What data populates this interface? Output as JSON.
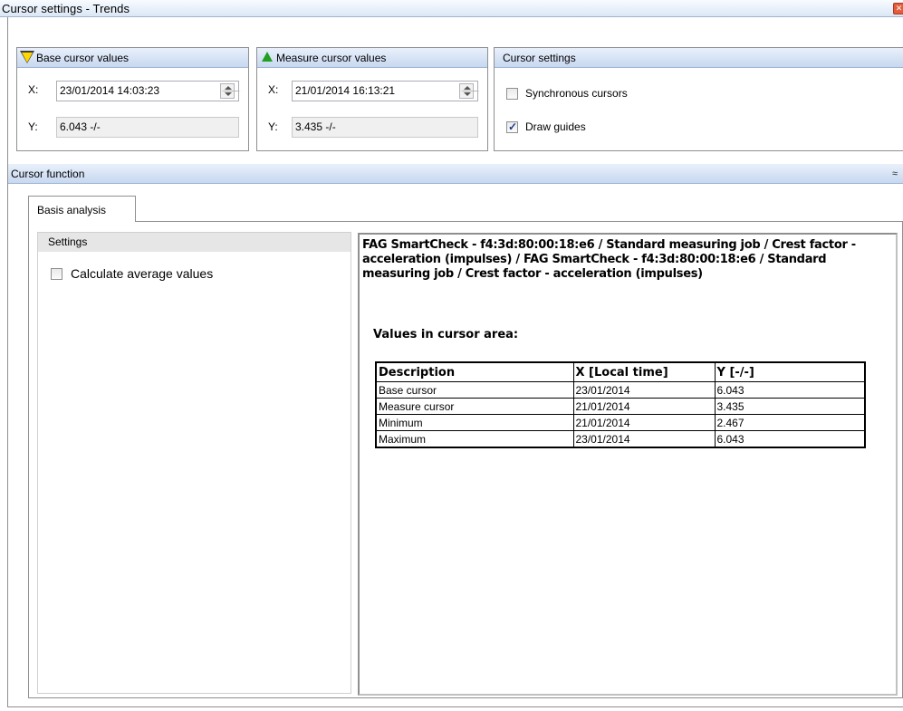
{
  "window": {
    "title": "Cursor settings - Trends",
    "close_glyph": "✕"
  },
  "base_cursor": {
    "header": "Base cursor values",
    "x_label": "X:",
    "x_value": "23/01/2014 14:03:23",
    "y_label": "Y:",
    "y_value": "6.043 -/-"
  },
  "measure_cursor": {
    "header": "Measure cursor values",
    "x_label": "X:",
    "x_value": "21/01/2014 16:13:21",
    "y_label": "Y:",
    "y_value": "3.435 -/-"
  },
  "cursor_settings": {
    "header": "Cursor settings",
    "synchronous": {
      "label": "Synchronous cursors",
      "checked": false
    },
    "draw_guides": {
      "label": "Draw guides",
      "checked": true
    }
  },
  "cursor_function": {
    "header": "Cursor function",
    "collapse_glyph": "≈",
    "tabs": [
      {
        "label": "Basis analysis",
        "selected": true
      }
    ],
    "settings": {
      "header": "Settings",
      "average": {
        "label": "Calculate average values",
        "checked": false
      }
    },
    "report": {
      "title": "FAG SmartCheck - f4:3d:80:00:18:e6 / Standard measuring job / Crest factor - acceleration (impulses) / FAG SmartCheck - f4:3d:80:00:18:e6 / Standard measuring job / Crest factor - acceleration (impulses)",
      "subtitle": "Values in cursor area:",
      "columns": [
        "Description",
        "X [Local time]",
        "Y [-/-]"
      ],
      "rows": [
        [
          "Base cursor",
          "23/01/2014",
          "6.043"
        ],
        [
          "Measure cursor",
          "21/01/2014",
          "3.435"
        ],
        [
          "Minimum",
          "21/01/2014",
          "2.467"
        ],
        [
          "Maximum",
          "23/01/2014",
          "6.043"
        ]
      ]
    }
  },
  "colors": {
    "header_gradient_top": "#e9f0fb",
    "header_gradient_bottom": "#c7d8f0",
    "base_marker": "#ffd800",
    "measure_marker": "#1fa023"
  }
}
